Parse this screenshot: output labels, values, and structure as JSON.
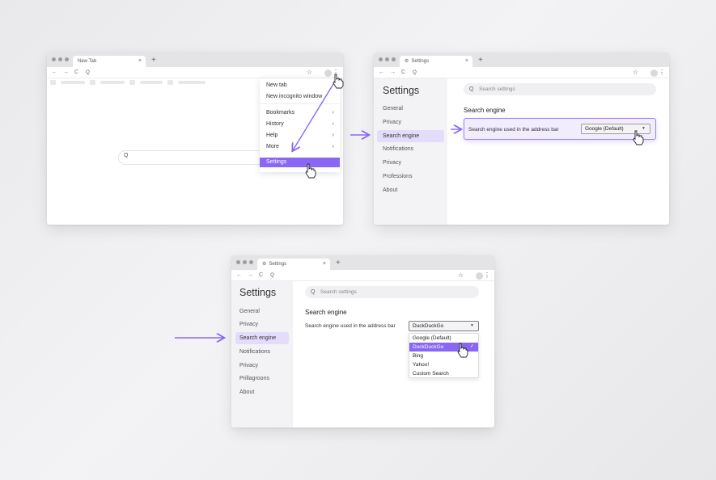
{
  "colors": {
    "accent": "#8a67f2",
    "accent_light": "#e4dcfb",
    "arrow": "#8a67f2"
  },
  "window1": {
    "tab_title": "New Tab",
    "tab_close": "×",
    "new_tab": "+",
    "nav": {
      "back": "←",
      "forward": "→",
      "reload": "C",
      "search": "Q"
    },
    "star": "☆",
    "kebab": "⋮",
    "menu": {
      "items": [
        {
          "label": "New tab"
        },
        {
          "label": "New incognito window"
        },
        {
          "label": "Bookmarks",
          "chevron": "›"
        },
        {
          "label": "History",
          "chevron": "›"
        },
        {
          "label": "Help",
          "chevron": "›"
        },
        {
          "label": "More",
          "chevron": "›"
        },
        {
          "label": "Settings"
        }
      ]
    },
    "search_icon": "Q"
  },
  "window2": {
    "tab_title": "Settings",
    "tab_icon": "⚙",
    "tab_close": "×",
    "new_tab": "+",
    "nav": {
      "back": "←",
      "forward": "→",
      "reload": "C",
      "search": "Q"
    },
    "star": "☆",
    "kebab": "⋮",
    "title": "Settings",
    "sidebar": [
      "General",
      "Privacy",
      "Search engine",
      "Notifications",
      "Privacy",
      "Professions",
      "About"
    ],
    "search_placeholder": "Search settings",
    "search_icon": "Q",
    "section_title": "Search engine",
    "row_label": "Search engine used in the address bar",
    "select_value": "Google (Default)",
    "caret": "▼"
  },
  "window3": {
    "tab_title": "Settings",
    "tab_icon": "⚙",
    "tab_close": "×",
    "new_tab": "+",
    "nav": {
      "back": "←",
      "forward": "→",
      "reload": "C",
      "search": "Q"
    },
    "star": "☆",
    "kebab": "⋮",
    "title": "Settings",
    "sidebar": [
      "General",
      "Privacy",
      "Search engine",
      "Notifications",
      "Privacy",
      "Prillagroons",
      "About"
    ],
    "search_placeholder": "Search settings",
    "search_icon": "Q",
    "section_title": "Search engine",
    "row_label": "Search engine used in the address bar",
    "select_value": "DuckDuckGo",
    "caret": "▼",
    "dropdown": [
      {
        "label": "Google (Default)"
      },
      {
        "label": "DuckDuckGo",
        "check": "✓"
      },
      {
        "label": "Bing"
      },
      {
        "label": "Yahoo!"
      },
      {
        "label": "Custom Search"
      }
    ]
  }
}
